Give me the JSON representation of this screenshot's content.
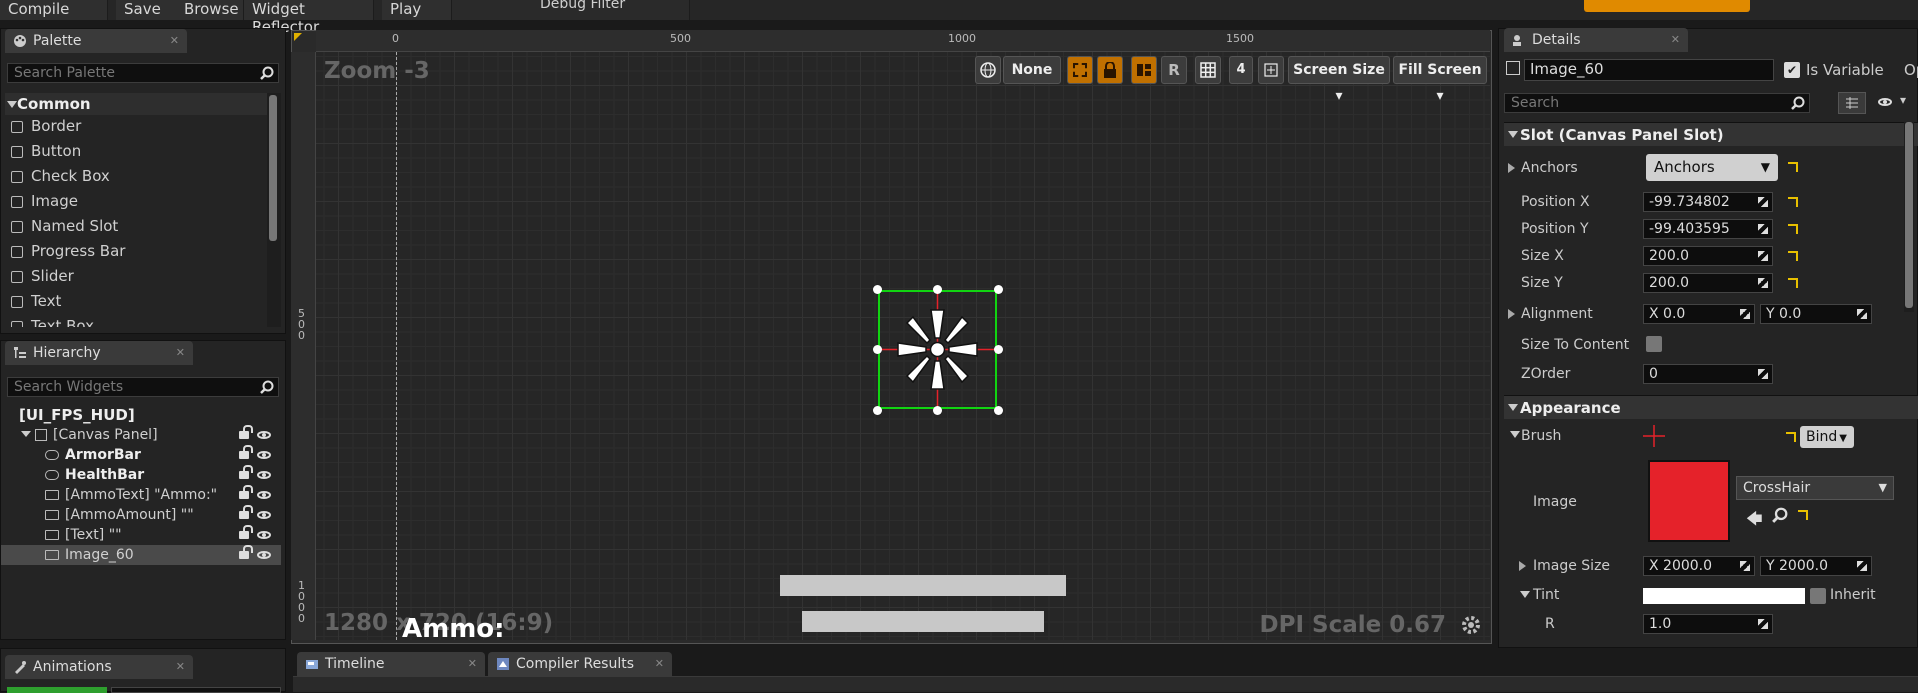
{
  "toolbar": {
    "compile": "Compile",
    "save": "Save",
    "browse": "Browse",
    "widget_reflector": "Widget Reflector",
    "play": "Play",
    "debug_filter": "Debug Filter"
  },
  "palette": {
    "title": "Palette",
    "search_placeholder": "Search Palette",
    "category": "Common",
    "items": [
      {
        "label": "Border",
        "icon": "border-icon"
      },
      {
        "label": "Button",
        "icon": "button-icon"
      },
      {
        "label": "Check Box",
        "icon": "checkbox-icon"
      },
      {
        "label": "Image",
        "icon": "image-icon"
      },
      {
        "label": "Named Slot",
        "icon": "named-slot-icon"
      },
      {
        "label": "Progress Bar",
        "icon": "progress-bar-icon"
      },
      {
        "label": "Slider",
        "icon": "slider-icon"
      },
      {
        "label": "Text",
        "icon": "text-icon"
      },
      {
        "label": "Text Box",
        "icon": "text-box-icon"
      }
    ]
  },
  "hierarchy": {
    "title": "Hierarchy",
    "search_placeholder": "Search Widgets",
    "root": "[UI_FPS_HUD]",
    "canvas": "[Canvas Panel]",
    "items": [
      {
        "label": "ArmorBar",
        "bold": true,
        "icon": "progress-bar-icon"
      },
      {
        "label": "HealthBar",
        "bold": true,
        "icon": "progress-bar-icon"
      },
      {
        "label": "[AmmoText] \"Ammo:\"",
        "bold": false,
        "icon": "text-icon"
      },
      {
        "label": "[AmmoAmount] \"\"",
        "bold": false,
        "icon": "text-icon"
      },
      {
        "label": "[Text] \"\"",
        "bold": false,
        "icon": "text-icon"
      },
      {
        "label": "Image_60",
        "bold": false,
        "icon": "image-icon",
        "selected": true
      }
    ]
  },
  "animations": {
    "title": "Animations"
  },
  "designer": {
    "zoom": "Zoom -3",
    "resolution": "1280 x 720 (16:9)",
    "dpi": "DPI Scale 0.67",
    "ammo_label": "Ammo:",
    "ruler_top": [
      "0",
      "500",
      "1000",
      "1500"
    ],
    "ruler_left_500": "5\n0\n0",
    "ruler_left_1000": "1\n0\n0\n0",
    "none_btn": "None",
    "r_btn": "R",
    "grid_num": "4",
    "screen_size": "Screen Size",
    "fill_screen": "Fill Screen"
  },
  "bottom_tabs": {
    "timeline": "Timeline",
    "compiler": "Compiler Results"
  },
  "details": {
    "title": "Details",
    "name_value": "Image_60",
    "is_variable": "Is Variable",
    "search_placeholder": "Search",
    "slot_section": "Slot (Canvas Panel Slot)",
    "anchors_label": "Anchors",
    "anchors_value": "Anchors",
    "position_x_label": "Position X",
    "position_x": "-99.734802",
    "position_y_label": "Position Y",
    "position_y": "-99.403595",
    "size_x_label": "Size X",
    "size_x": "200.0",
    "size_y_label": "Size Y",
    "size_y": "200.0",
    "alignment_label": "Alignment",
    "align_x": "X  0.0",
    "align_y": "Y  0.0",
    "size_to_content": "Size To Content",
    "zorder_label": "ZOrder",
    "zorder": "0",
    "appearance_section": "Appearance",
    "brush_label": "Brush",
    "bind_label": "Bind",
    "image_label": "Image",
    "image_asset": "CrossHair",
    "image_size_label": "Image Size",
    "image_size_x": "X  2000.0",
    "image_size_y": "Y  2000.0",
    "tint_label": "Tint",
    "inherit": "Inherit",
    "r_label": "R",
    "r_value": "1.0",
    "op_label": "Op"
  },
  "colors": {
    "accent": "#e08a00",
    "selection": "#00c000",
    "brush": "#e5222a"
  }
}
